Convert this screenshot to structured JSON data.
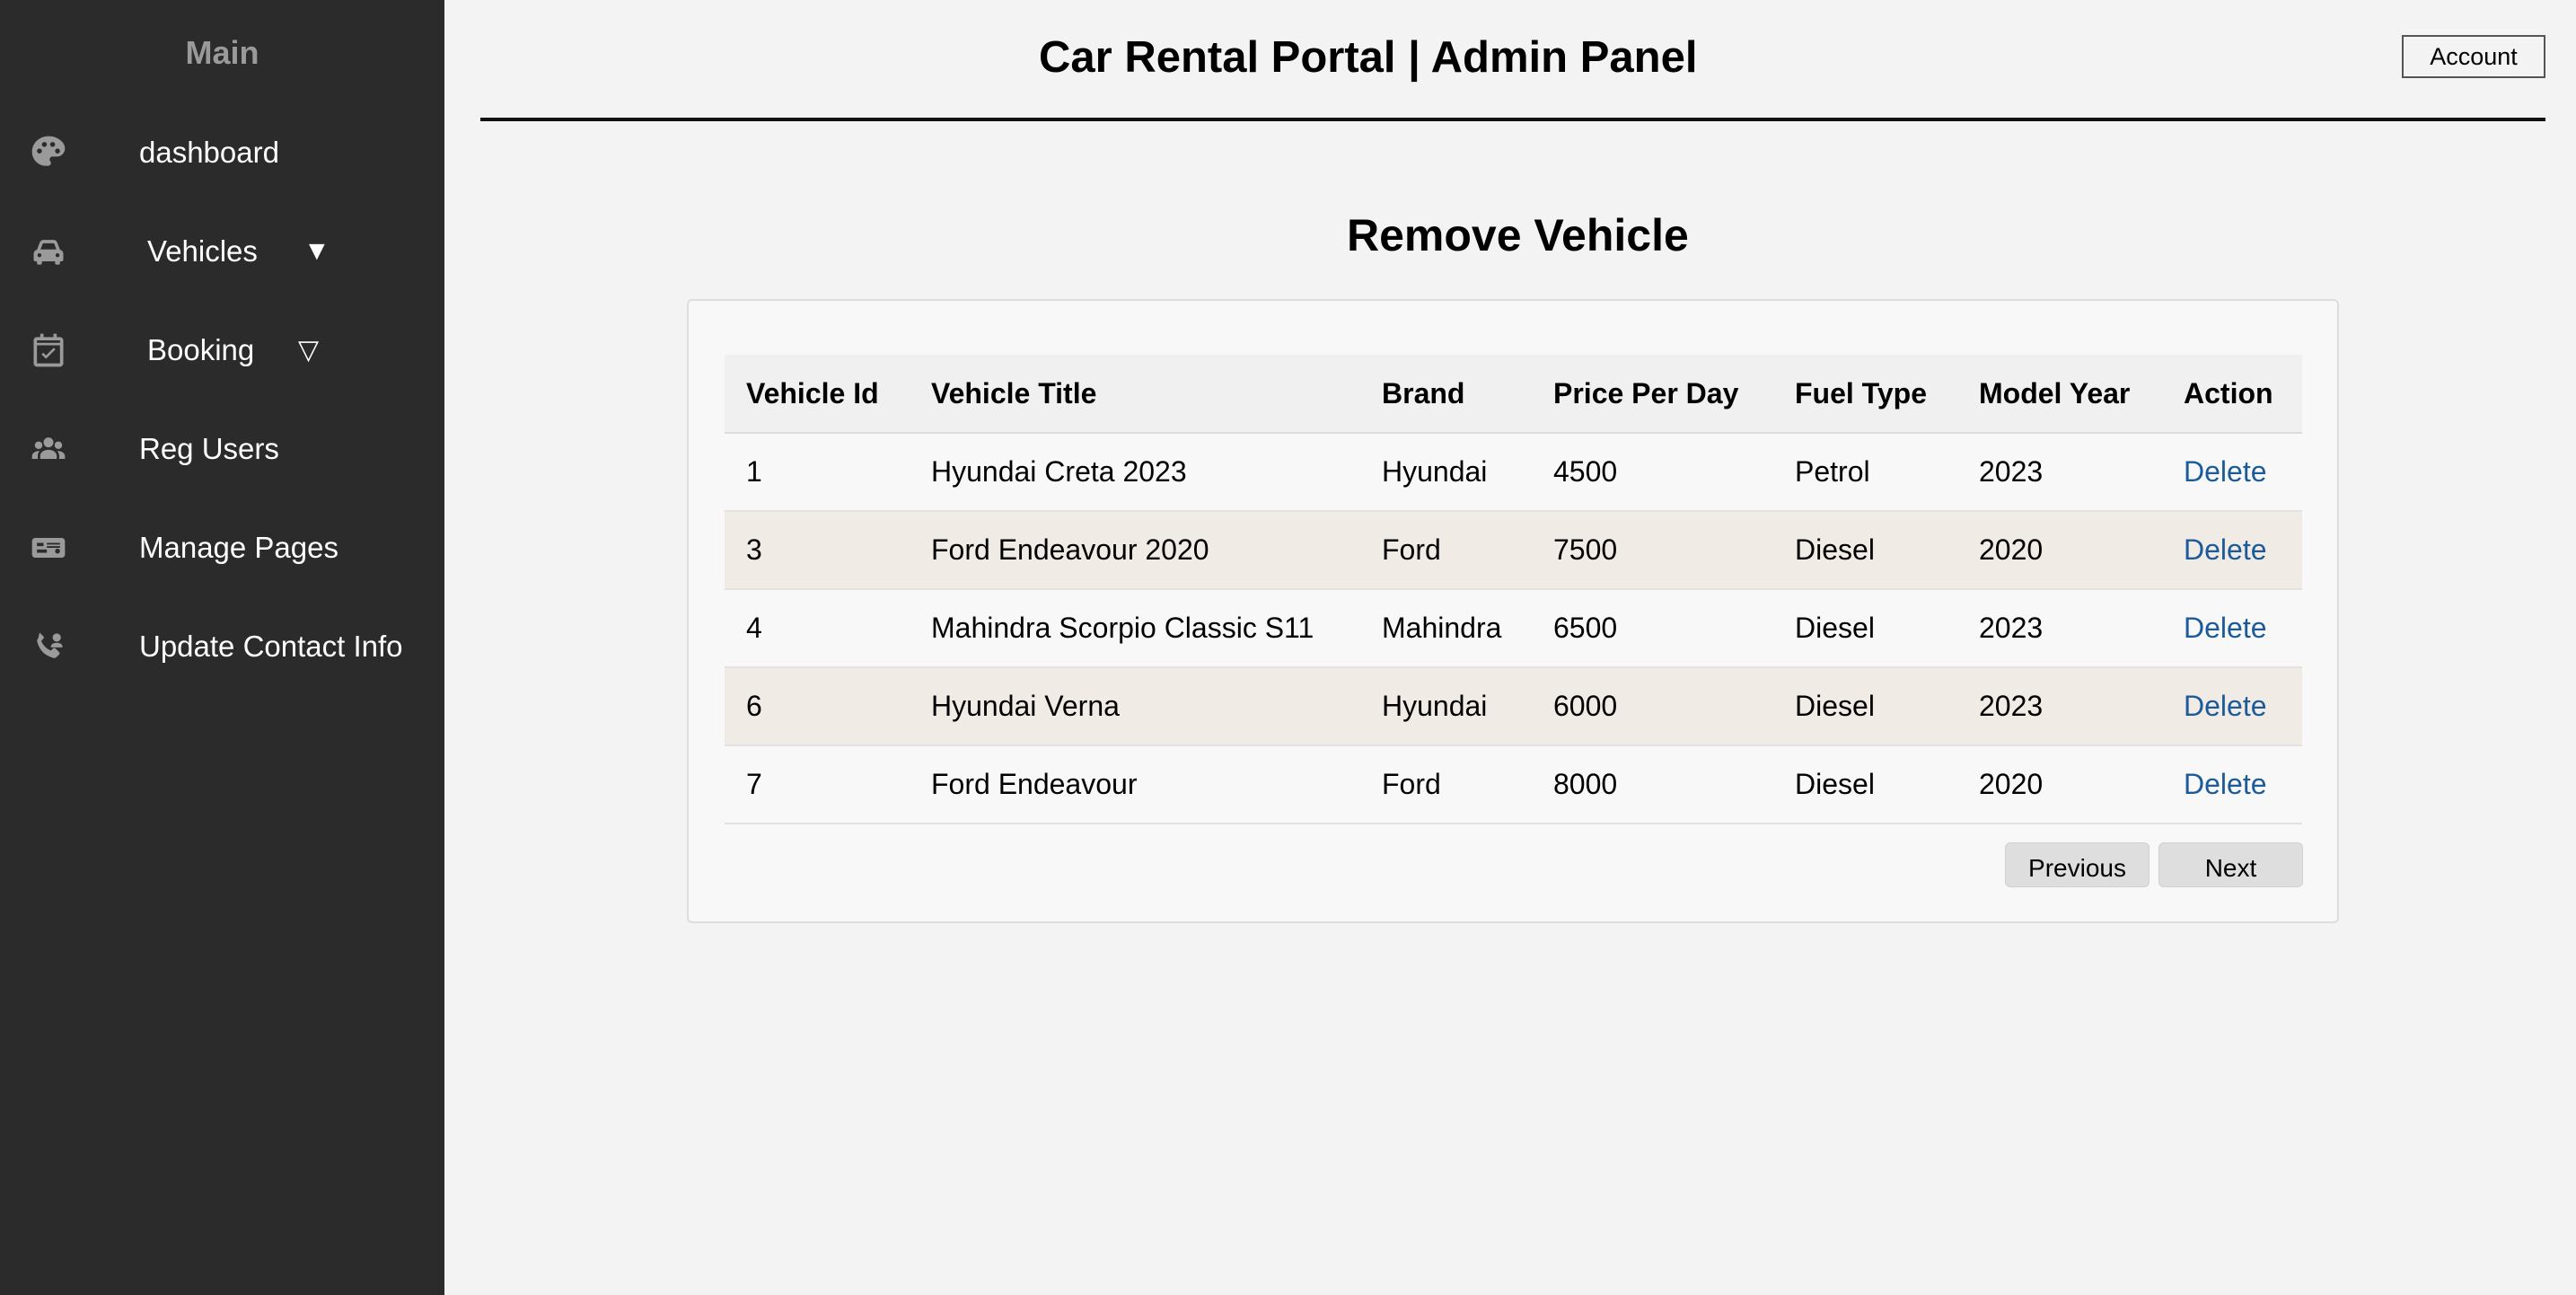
{
  "sidebar": {
    "title": "Main",
    "items": [
      {
        "label": "dashboard",
        "icon": "palette-icon"
      },
      {
        "label": "Vehicles",
        "icon": "car-icon",
        "caret": "▼"
      },
      {
        "label": "Booking",
        "icon": "calendar-check-icon",
        "caret": "▽"
      },
      {
        "label": "Reg Users",
        "icon": "users-icon"
      },
      {
        "label": "Manage Pages",
        "icon": "id-card-icon"
      },
      {
        "label": "Update Contact Info",
        "icon": "contact-phone-icon"
      }
    ]
  },
  "header": {
    "title": "Car Rental Portal | Admin Panel",
    "account_label": "Account"
  },
  "main": {
    "heading": "Remove Vehicle",
    "table": {
      "headers": [
        "Vehicle Id",
        "Vehicle Title",
        "Brand",
        "Price Per Day",
        "Fuel Type",
        "Model Year",
        "Action"
      ],
      "rows": [
        [
          "1",
          "Hyundai Creta 2023",
          "Hyundai",
          "4500",
          "Petrol",
          "2023",
          "Delete"
        ],
        [
          "3",
          "Ford Endeavour 2020",
          "Ford",
          "7500",
          "Diesel",
          "2020",
          "Delete"
        ],
        [
          "4",
          "Mahindra Scorpio Classic S11",
          "Mahindra",
          "6500",
          "Diesel",
          "2023",
          "Delete"
        ],
        [
          "6",
          "Hyundai Verna",
          "Hyundai",
          "6000",
          "Diesel",
          "2023",
          "Delete"
        ],
        [
          "7",
          "Ford Endeavour",
          "Ford",
          "8000",
          "Diesel",
          "2020",
          "Delete"
        ]
      ]
    },
    "pagination": {
      "previous": "Previous",
      "next": "Next"
    }
  },
  "colors": {
    "sidebar_bg": "#2b2b2b",
    "page_bg": "#f3f3f3",
    "link": "#1b5b99",
    "row_alt": "#f0ebe4"
  }
}
